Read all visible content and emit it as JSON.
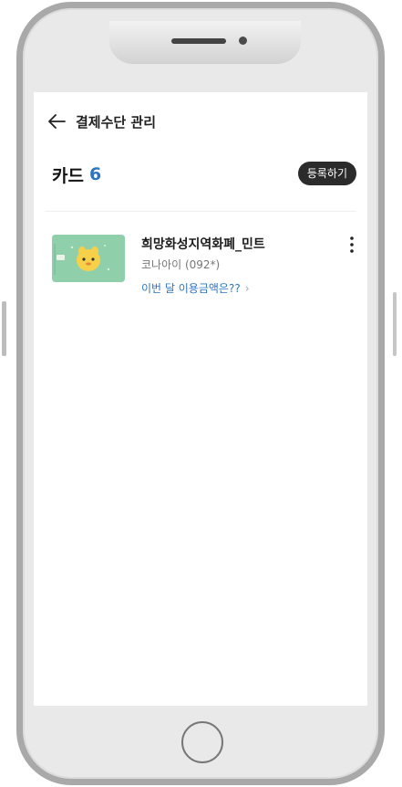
{
  "header": {
    "title": "결제수단 관리",
    "back_icon": "arrow-left-icon"
  },
  "cards_section": {
    "title": "카드",
    "count": "6",
    "register_label": "등록하기"
  },
  "cards": [
    {
      "name": "희망화성지역화폐_민트",
      "sub": "코나아이 (092*)",
      "link_label": "이번 달 이용금액은??",
      "link_chevron": "›",
      "more_icon": "more-vertical-icon",
      "card_color": "#8fd0ab"
    }
  ],
  "colors": {
    "accent": "#2f74c0",
    "button_dark": "#2b2b2b"
  }
}
